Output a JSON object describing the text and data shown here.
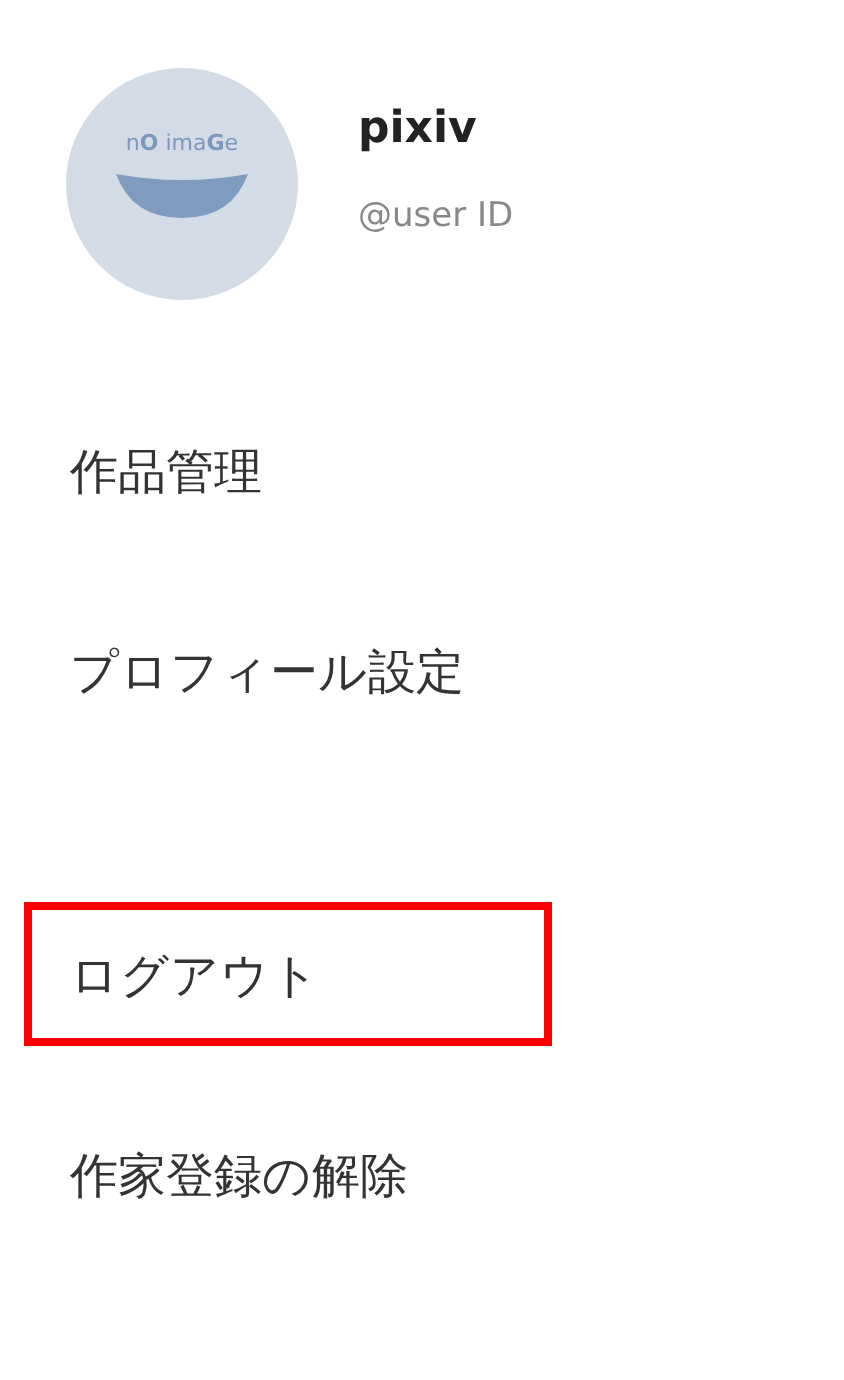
{
  "profile": {
    "avatar_text": "n**O** ima**G**e",
    "name": "pixiv",
    "user_id": "@user ID"
  },
  "menu_groups": [
    {
      "items": [
        {
          "label": "作品管理",
          "highlighted": false
        },
        {
          "label": "プロフィール設定",
          "highlighted": false
        }
      ]
    },
    {
      "items": [
        {
          "label": "ログアウト",
          "highlighted": true
        },
        {
          "label": "作家登録の解除",
          "highlighted": false
        }
      ]
    }
  ]
}
